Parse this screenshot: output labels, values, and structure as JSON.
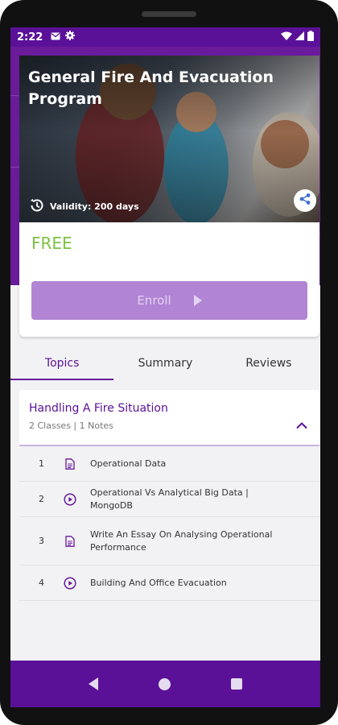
{
  "status_bar": {
    "time": "2:22"
  },
  "course": {
    "title": "General Fire And Evacuation Program",
    "validity": "Validity: 200 days",
    "price": "FREE",
    "enroll_label": "Enroll"
  },
  "tabs": [
    {
      "label": "Topics",
      "active": true
    },
    {
      "label": "Summary",
      "active": false
    },
    {
      "label": "Reviews",
      "active": false
    }
  ],
  "section": {
    "title": "Handling A Fire Situation",
    "subtitle": "2 Classes | 1 Notes",
    "lessons": [
      {
        "num": "1",
        "icon": "document-icon",
        "title": "Operational Data"
      },
      {
        "num": "2",
        "icon": "play-circle-icon",
        "title": "Operational Vs Analytical Big Data | MongoDB"
      },
      {
        "num": "3",
        "icon": "document-icon",
        "title": "Write An Essay On Analysing Operational Performance"
      },
      {
        "num": "4",
        "icon": "play-circle-icon",
        "title": "Building And Office Evacuation"
      }
    ]
  },
  "colors": {
    "primary": "#6a1b9a",
    "price": "#7cc242",
    "enroll_bg": "#b184d4"
  }
}
